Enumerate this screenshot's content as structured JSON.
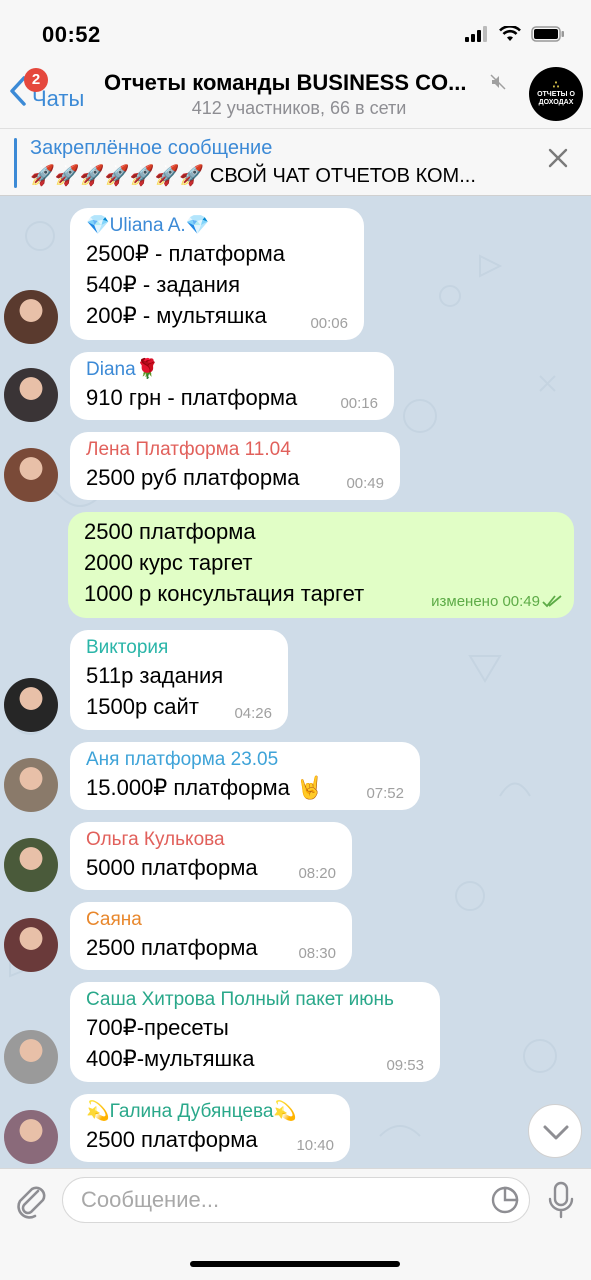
{
  "status_bar": {
    "time": "00:52"
  },
  "header": {
    "back_label": "Чаты",
    "unread_badge": "2",
    "title": "Отчеты команды BUSINESS CO...",
    "subtitle": "412 участников, 66 в сети",
    "channel_avatar_text": "ОТЧЕТЫ О ДОХОДАХ",
    "icons": [
      "chevron-left-icon",
      "mute-icon"
    ]
  },
  "pinned": {
    "title": "Закреплённое сообщение",
    "text": "🚀🚀🚀🚀🚀🚀🚀 СВОЙ ЧАТ ОТЧЕТОВ КОМ..."
  },
  "messages": [
    {
      "sender": "💎Uliana A.💎",
      "sender_color": "#3c8ad6",
      "lines": [
        "2500₽ - платформа",
        "540₽ - задания",
        "200₽ - мультяшка"
      ],
      "time": "00:06",
      "avatar_color": "#5a3a2e"
    },
    {
      "sender": "Diana🌹",
      "sender_color": "#3c8ad6",
      "lines": [
        "910 грн - платформа"
      ],
      "time": "00:16",
      "avatar_color": "#3a3436"
    },
    {
      "sender": "Лена Платформа 11.04",
      "sender_color": "#e1605b",
      "lines": [
        "2500 руб платформа"
      ],
      "time": "00:49",
      "avatar_color": "#7a4a38"
    },
    {
      "outgoing": true,
      "lines": [
        "2500 платформа",
        "2000 курс таргет",
        "1000 р консультация таргет"
      ],
      "time": "изменено 00:49"
    },
    {
      "sender": "Виктория",
      "sender_color": "#2ab5a8",
      "lines": [
        "511р задания",
        "1500р сайт"
      ],
      "time": "04:26",
      "avatar_color": "#262626"
    },
    {
      "sender": "Аня платформа 23.05",
      "sender_color": "#3ea3d8",
      "lines": [
        "15.000₽ платформа 🤘"
      ],
      "time": "07:52",
      "avatar_color": "#8a7a6a"
    },
    {
      "sender": "Ольга Кулькова",
      "sender_color": "#e1605b",
      "lines": [
        "5000 платформа"
      ],
      "time": "08:20",
      "avatar_color": "#4a5a3a"
    },
    {
      "sender": "Саяна",
      "sender_color": "#e8872c",
      "lines": [
        "2500 платформа"
      ],
      "time": "08:30",
      "avatar_color": "#6a3a3a"
    },
    {
      "sender": "Саша Хитрова Полный пакет июнь",
      "sender_color": "#2aa88a",
      "lines": [
        "700₽-пресеты",
        "400₽-мультяшка"
      ],
      "time": "09:53",
      "avatar_color": "#9a9a9a"
    },
    {
      "sender": "💫Галина Дубянцева💫",
      "sender_color": "#2aa88a",
      "lines": [
        "2500 платформа"
      ],
      "time": "10:40",
      "avatar_color": "#8a6a7a"
    }
  ],
  "composer": {
    "placeholder": "Сообщение..."
  }
}
